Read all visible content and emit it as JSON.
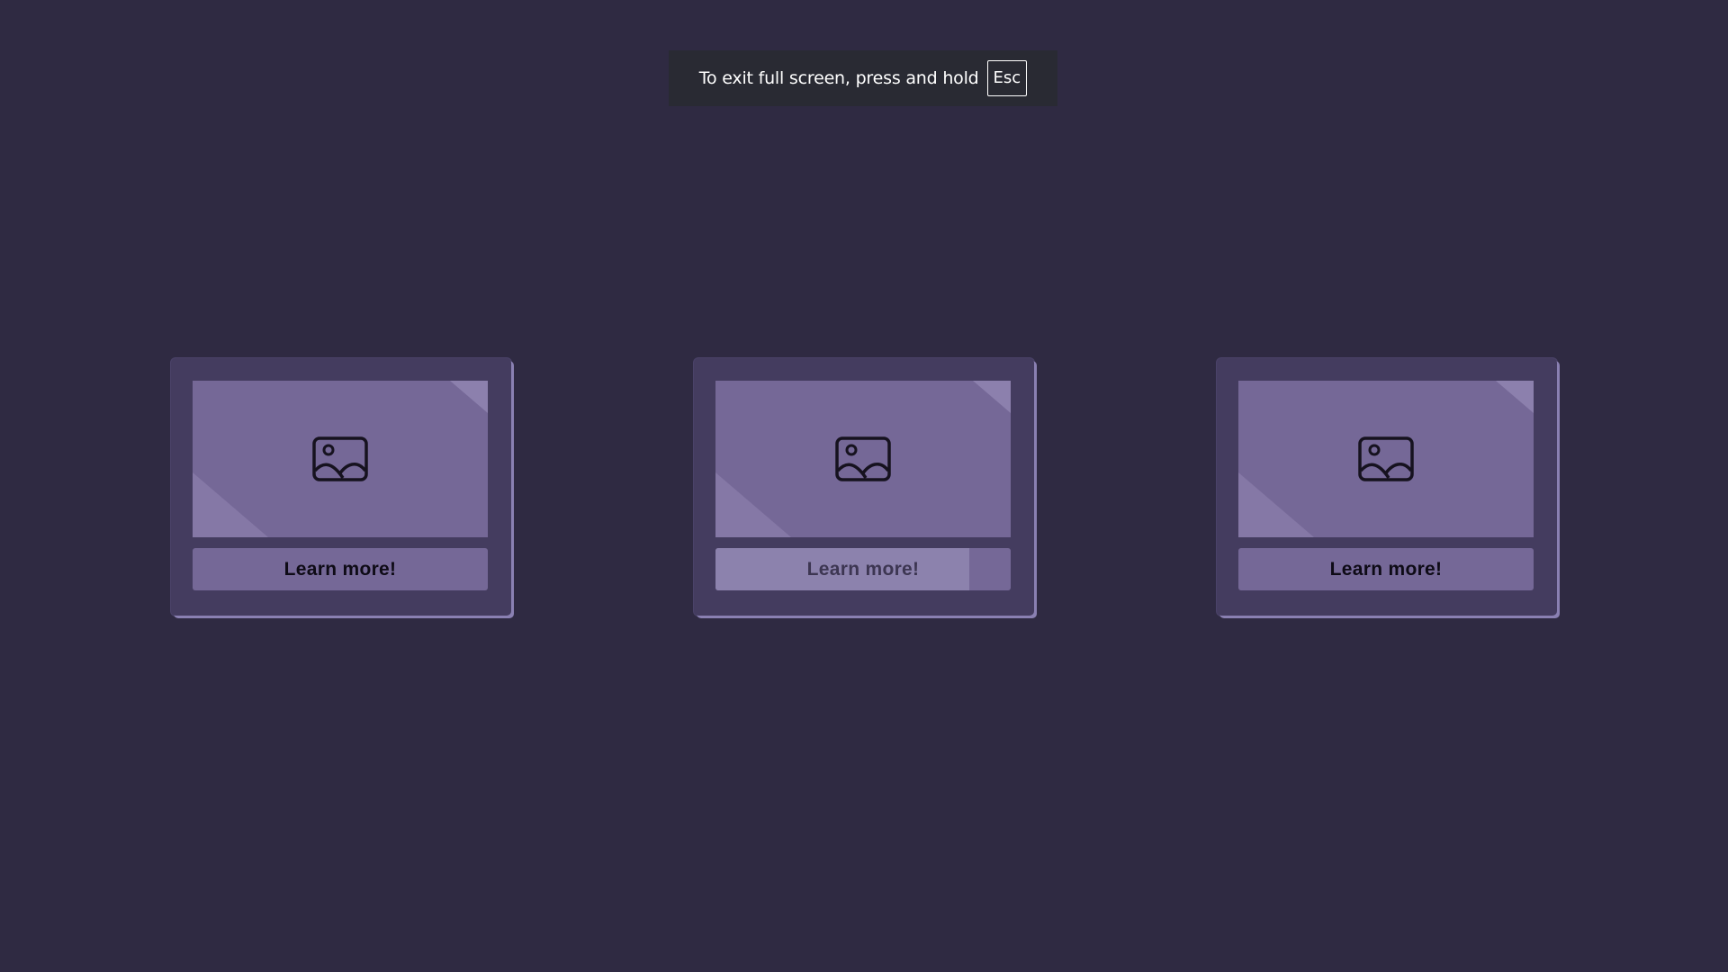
{
  "fullscreen_notice": {
    "text": "To exit full screen, press and hold",
    "key": "Esc"
  },
  "cards": [
    {
      "image_icon": "image-icon",
      "button_label": "Learn more!",
      "button_fill_fraction": 0
    },
    {
      "image_icon": "image-icon",
      "button_label": "Learn more!",
      "button_fill_fraction": 0.86
    },
    {
      "image_icon": "image-icon",
      "button_label": "Learn more!",
      "button_fill_fraction": 0
    }
  ],
  "colors": {
    "background": "#2f2a42",
    "card": "#443c5f",
    "card_shadow": "#8a80b2",
    "image_placeholder": "#756897",
    "button": "#756897",
    "button_hover_fill": "#8c82ad",
    "toast": "#292a33"
  }
}
